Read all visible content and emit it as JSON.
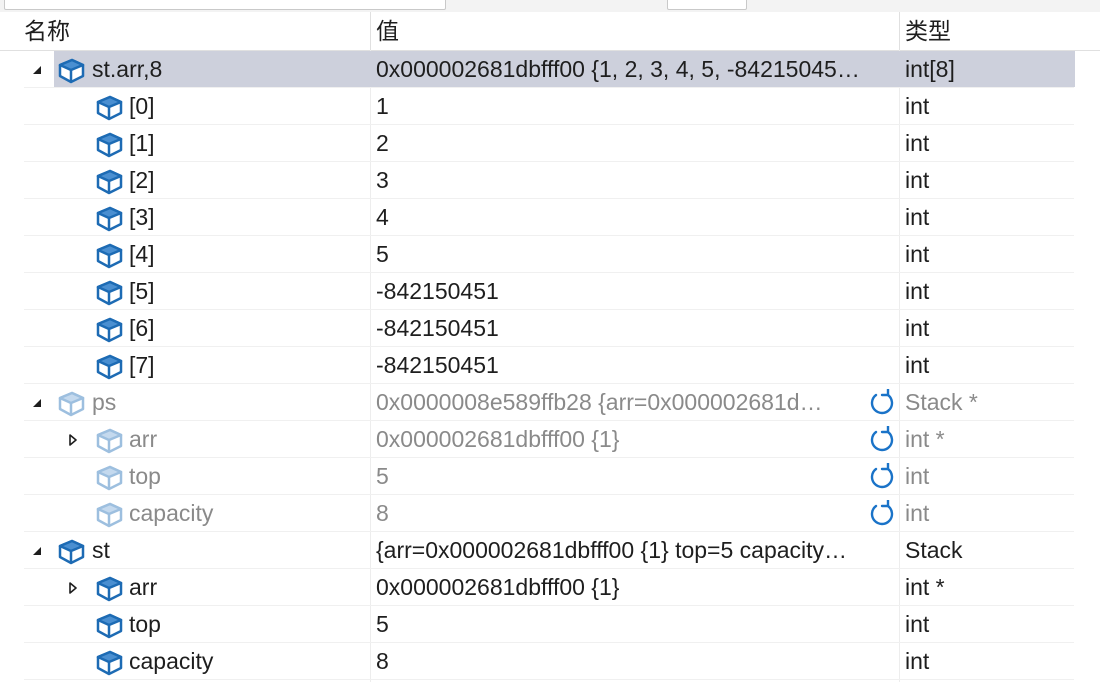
{
  "header": {
    "name_label": "名称",
    "value_label": "值",
    "type_label": "类型"
  },
  "rows": [
    {
      "name": "st.arr,8",
      "value": "0x000002681dbfff00 {1, 2, 3, 4, 5, -84215045…",
      "type": "int[8]"
    },
    {
      "name": "[0]",
      "value": "1",
      "type": "int"
    },
    {
      "name": "[1]",
      "value": "2",
      "type": "int"
    },
    {
      "name": "[2]",
      "value": "3",
      "type": "int"
    },
    {
      "name": "[3]",
      "value": "4",
      "type": "int"
    },
    {
      "name": "[4]",
      "value": "5",
      "type": "int"
    },
    {
      "name": "[5]",
      "value": "-842150451",
      "type": "int"
    },
    {
      "name": "[6]",
      "value": "-842150451",
      "type": "int"
    },
    {
      "name": "[7]",
      "value": "-842150451",
      "type": "int"
    },
    {
      "name": "ps",
      "value": "0x0000008e589ffb28 {arr=0x000002681d…",
      "type": "Stack *"
    },
    {
      "name": "arr",
      "value": "0x000002681dbfff00 {1}",
      "type": "int *"
    },
    {
      "name": "top",
      "value": "5",
      "type": "int"
    },
    {
      "name": "capacity",
      "value": "8",
      "type": "int"
    },
    {
      "name": "st",
      "value": "{arr=0x000002681dbfff00 {1} top=5 capacity…",
      "type": "Stack"
    },
    {
      "name": "arr",
      "value": "0x000002681dbfff00 {1}",
      "type": "int *"
    },
    {
      "name": "top",
      "value": "5",
      "type": "int"
    },
    {
      "name": "capacity",
      "value": "8",
      "type": "int"
    }
  ],
  "icons": {
    "variable": "variable-icon",
    "refresh": "refresh-icon",
    "expanded": "expanded-arrow-icon",
    "collapsed": "collapsed-arrow-icon"
  },
  "colors": {
    "icon_blue": "#1d6bb4",
    "selected_row": "#cdd0dc",
    "stale_text": "#8a8a8a",
    "refresh_blue": "#1a73c8"
  }
}
